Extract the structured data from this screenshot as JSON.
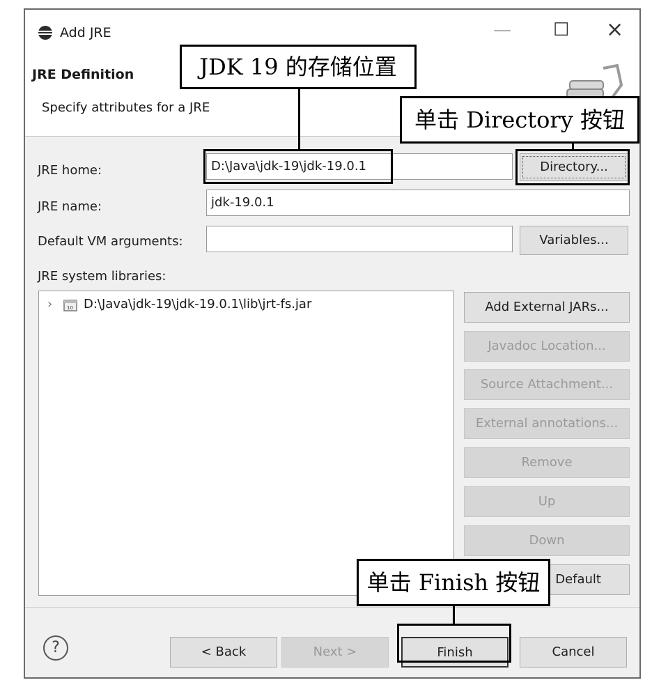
{
  "window": {
    "title": "Add JRE",
    "minimize_label": "—",
    "maximize_label": "☐",
    "close_label": "×"
  },
  "header": {
    "title": "JRE Definition",
    "subtitle": "Specify attributes for a JRE"
  },
  "form": {
    "jre_home_label": "JRE home:",
    "jre_home_value": "D:\\Java\\jdk-19\\jdk-19.0.1",
    "jre_name_label": "JRE name:",
    "jre_name_value": "jdk-19.0.1",
    "vm_args_label": "Default VM arguments:",
    "vm_args_value": "",
    "directory_button": "Directory...",
    "variables_button": "Variables...",
    "libraries_label": "JRE system libraries:"
  },
  "libraries": {
    "items": [
      {
        "label": "D:\\Java\\jdk-19\\jdk-19.0.1\\lib\\jrt-fs.jar",
        "expanded": false
      }
    ]
  },
  "library_buttons": {
    "add_external": "Add External JARs...",
    "javadoc": "Javadoc Location...",
    "source": "Source Attachment...",
    "external_annotations": "External annotations...",
    "remove": "Remove",
    "up": "Up",
    "down": "Down",
    "restore_default": "Default"
  },
  "footer": {
    "help_label": "?",
    "back": "< Back",
    "next": "Next >",
    "finish": "Finish",
    "cancel": "Cancel"
  },
  "annotations": {
    "jdk_location": "JDK 19 的存储位置",
    "click_directory": "单击 Directory 按钮",
    "click_finish": "单击 Finish 按钮"
  }
}
